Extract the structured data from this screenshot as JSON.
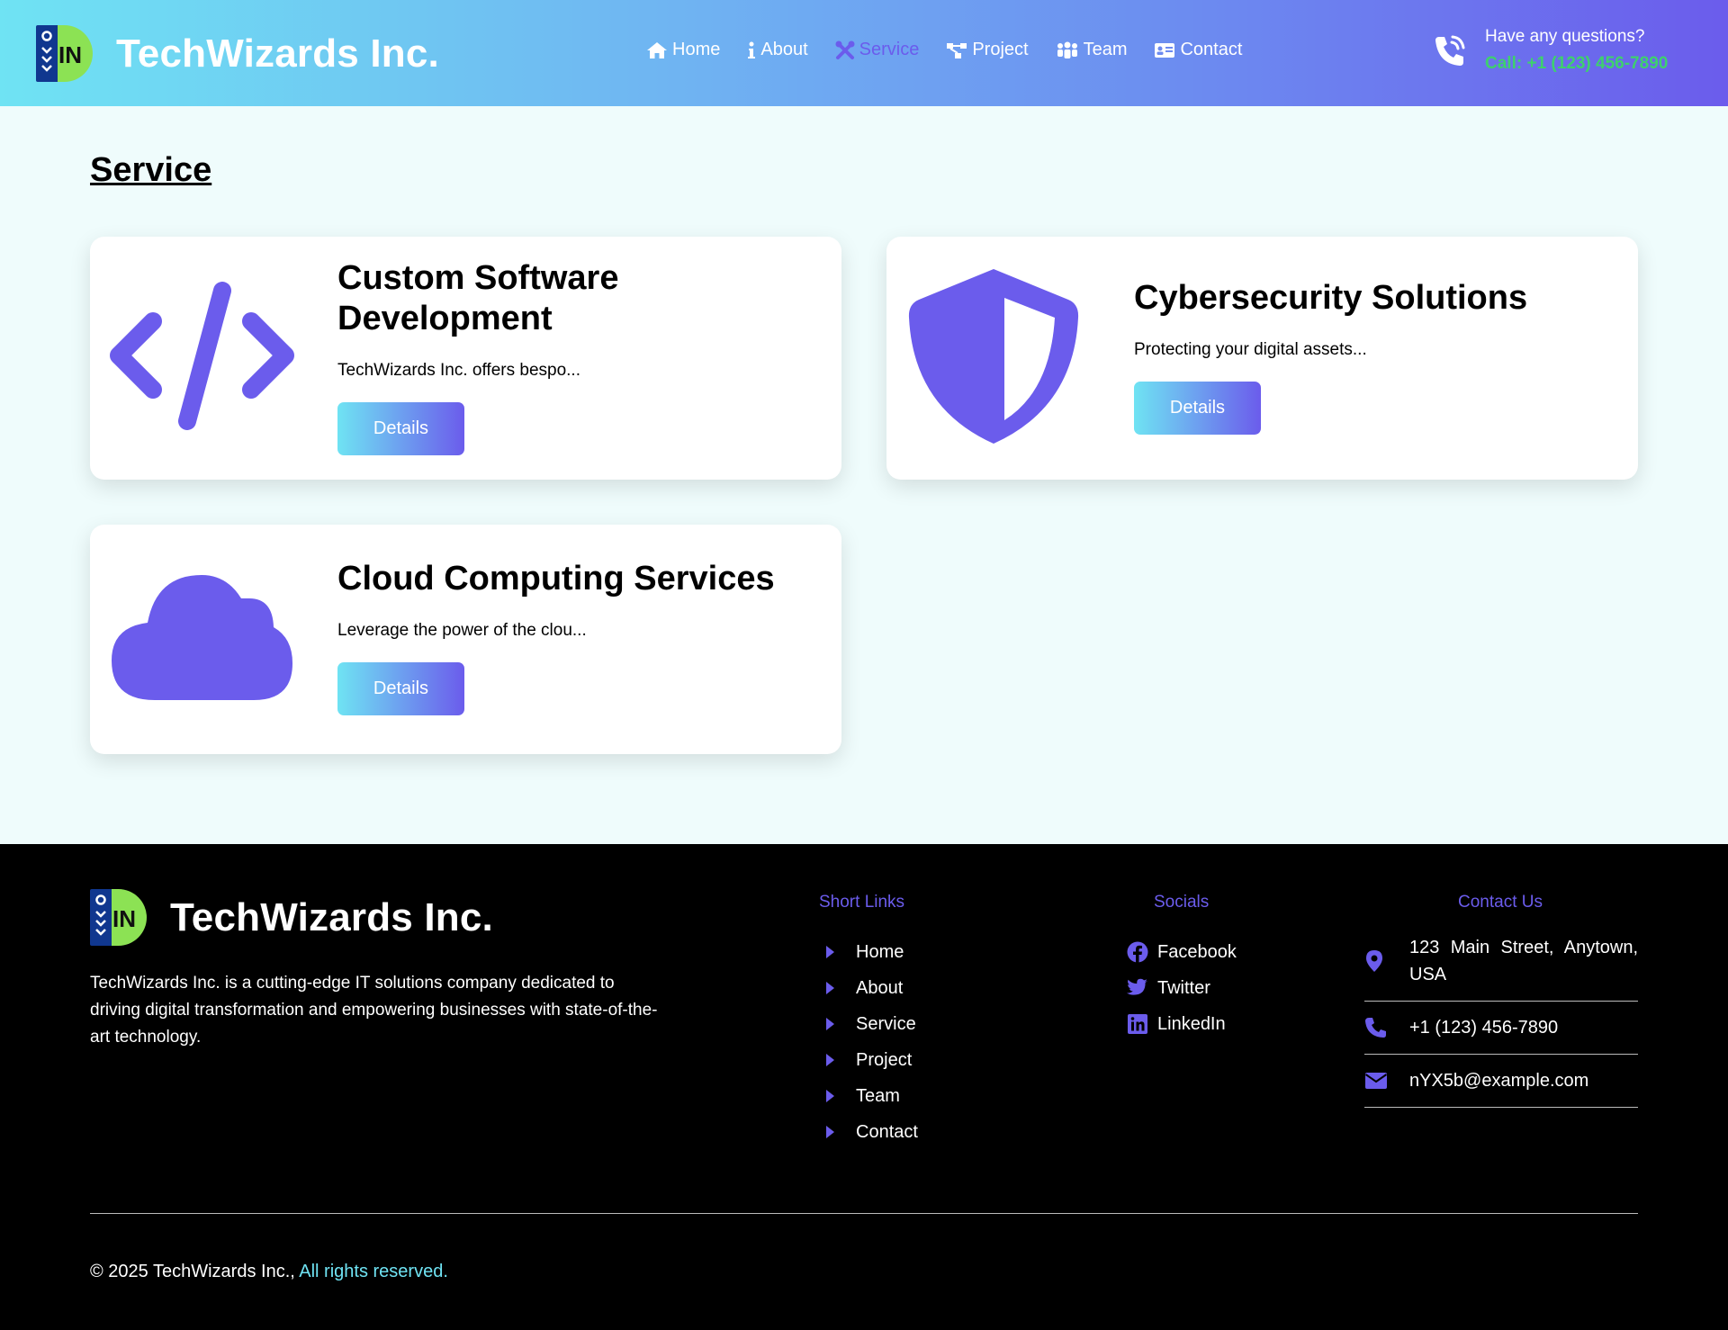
{
  "header": {
    "brand_name": "TechWizards Inc.",
    "logo_text": "IN",
    "nav": [
      {
        "label": "Home",
        "icon": "home-icon"
      },
      {
        "label": "About",
        "icon": "info-icon"
      },
      {
        "label": "Service",
        "icon": "tools-icon",
        "active": true
      },
      {
        "label": "Project",
        "icon": "project-icon"
      },
      {
        "label": "Team",
        "icon": "team-icon"
      },
      {
        "label": "Contact",
        "icon": "contact-card-icon"
      }
    ],
    "question": "Have any questions?",
    "call": "Call: +1 (123) 456-7890"
  },
  "main": {
    "title": "Service",
    "cards": [
      {
        "title": "Custom Software Development",
        "desc": "TechWizards Inc. offers bespo...",
        "button": "Details",
        "icon": "code-icon"
      },
      {
        "title": "Cybersecurity Solutions",
        "desc": "Protecting your digital assets...",
        "button": "Details",
        "icon": "shield-icon"
      },
      {
        "title": "Cloud Computing Services",
        "desc": "Leverage the power of the clou...",
        "button": "Details",
        "icon": "cloud-icon"
      }
    ]
  },
  "footer": {
    "brand_name": "TechWizards Inc.",
    "logo_text": "IN",
    "description": "TechWizards Inc. is a cutting-edge IT solutions company dedicated to driving digital transformation and empowering businesses with state-of-the-art technology.",
    "short_links_title": "Short Links",
    "short_links": [
      "Home",
      "About",
      "Service",
      "Project",
      "Team",
      "Contact"
    ],
    "socials_title": "Socials",
    "socials": [
      {
        "label": "Facebook",
        "icon": "facebook-icon"
      },
      {
        "label": "Twitter",
        "icon": "twitter-icon"
      },
      {
        "label": "LinkedIn",
        "icon": "linkedin-icon"
      }
    ],
    "contact_title": "Contact Us",
    "address": "123 Main Street, Anytown, USA",
    "phone": "+1 (123) 456-7890",
    "email": "nYX5b@example.com",
    "copyright": "© 2025 TechWizards Inc.,",
    "rights": "All rights reserved."
  },
  "colors": {
    "accent": "#6b5cec",
    "cyan": "#6fe3f3",
    "green": "#3ed06e",
    "page_bg": "#effcfc",
    "footer_bg": "#000000"
  }
}
